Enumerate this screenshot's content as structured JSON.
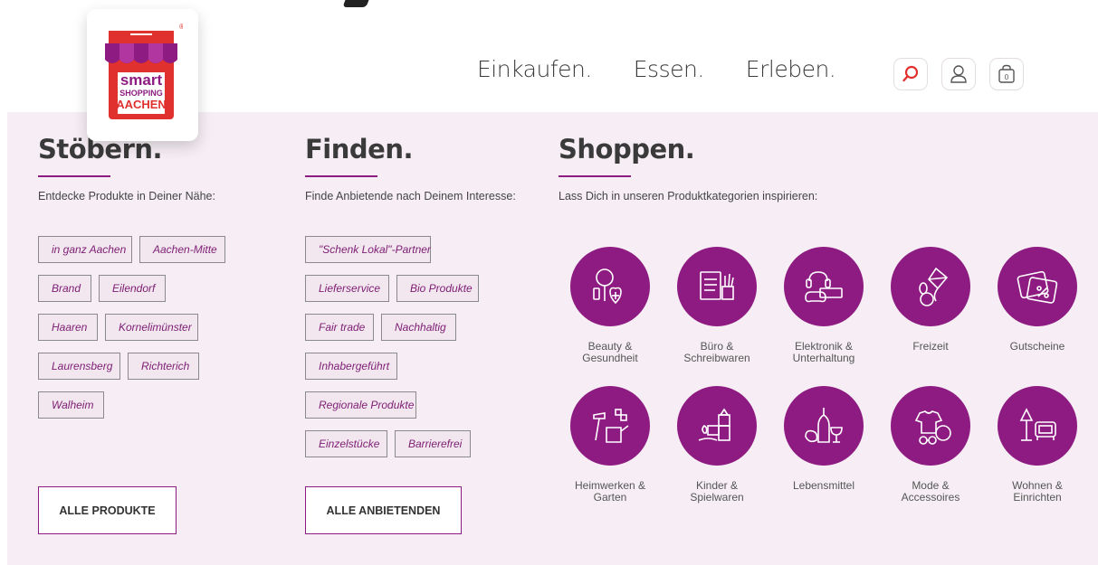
{
  "logo": {
    "line1": "smart",
    "line2": "SHOPPING",
    "line3": "AACHEN",
    "registered": "®"
  },
  "nav": {
    "items": [
      "Einkaufen.",
      "Essen.",
      "Erleben."
    ]
  },
  "header_icons": [
    "search-icon",
    "user-icon",
    "cart-icon"
  ],
  "cart": {
    "count": "0"
  },
  "colors": {
    "accent": "#8d1b82",
    "panel": "#f6eef4",
    "search": "#e0312e",
    "tag_bg": "#f2e6ef"
  },
  "browse": {
    "title": "Stöbern.",
    "subtitle": "Entdecke Produkte in Deiner Nähe:",
    "tags": [
      "in ganz Aachen",
      "Aachen-Mitte",
      "Brand",
      "Eilendorf",
      "Haaren",
      "Kornelimünster",
      "Laurensberg",
      "Richterich",
      "Walheim"
    ],
    "button": "ALLE PRODUKTE"
  },
  "find": {
    "title": "Finden.",
    "subtitle": "Finde Anbietende nach Deinem Interesse:",
    "tags": [
      "\"Schenk Lokal\"-Partner",
      "Lieferservice",
      "Bio Produkte",
      "Fair trade",
      "Nachhaltig",
      "Inhabergeführt",
      "Regionale Produkte",
      "Einzelstücke",
      "Barrierefrei"
    ],
    "button": "ALLE ANBIETENDEN"
  },
  "shop": {
    "title": "Shoppen.",
    "subtitle": "Lass Dich in unseren Produktkategorien inspirieren:",
    "categories": [
      {
        "label": "Beauty &\nGesundheit",
        "icon": "beauty-icon"
      },
      {
        "label": "Büro &\nSchreibwaren",
        "icon": "office-icon"
      },
      {
        "label": "Elektronik &\nUnterhaltung",
        "icon": "electronics-icon"
      },
      {
        "label": "Freizeit",
        "icon": "leisure-icon"
      },
      {
        "label": "Gutscheine",
        "icon": "voucher-icon"
      },
      {
        "label": "Heimwerken &\nGarten",
        "icon": "tools-garden-icon"
      },
      {
        "label": "Kinder &\nSpielwaren",
        "icon": "toys-icon"
      },
      {
        "label": "Lebensmittel",
        "icon": "food-icon"
      },
      {
        "label": "Mode &\nAccessoires",
        "icon": "fashion-icon"
      },
      {
        "label": "Wohnen &\nEinrichten",
        "icon": "living-icon"
      }
    ]
  }
}
